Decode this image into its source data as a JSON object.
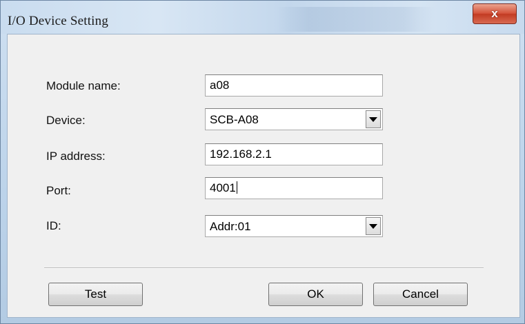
{
  "window": {
    "title": "I/O Device Setting",
    "close_label": "x"
  },
  "form": {
    "module_name": {
      "label": "Module name:",
      "value": "a08"
    },
    "device": {
      "label": "Device:",
      "value": "SCB-A08"
    },
    "ip_address": {
      "label": "IP address:",
      "value": "192.168.2.1"
    },
    "port": {
      "label": "Port:",
      "value": "4001"
    },
    "id": {
      "label": "ID:",
      "value": "Addr:01"
    }
  },
  "buttons": {
    "test": "Test",
    "ok": "OK",
    "cancel": "Cancel"
  }
}
